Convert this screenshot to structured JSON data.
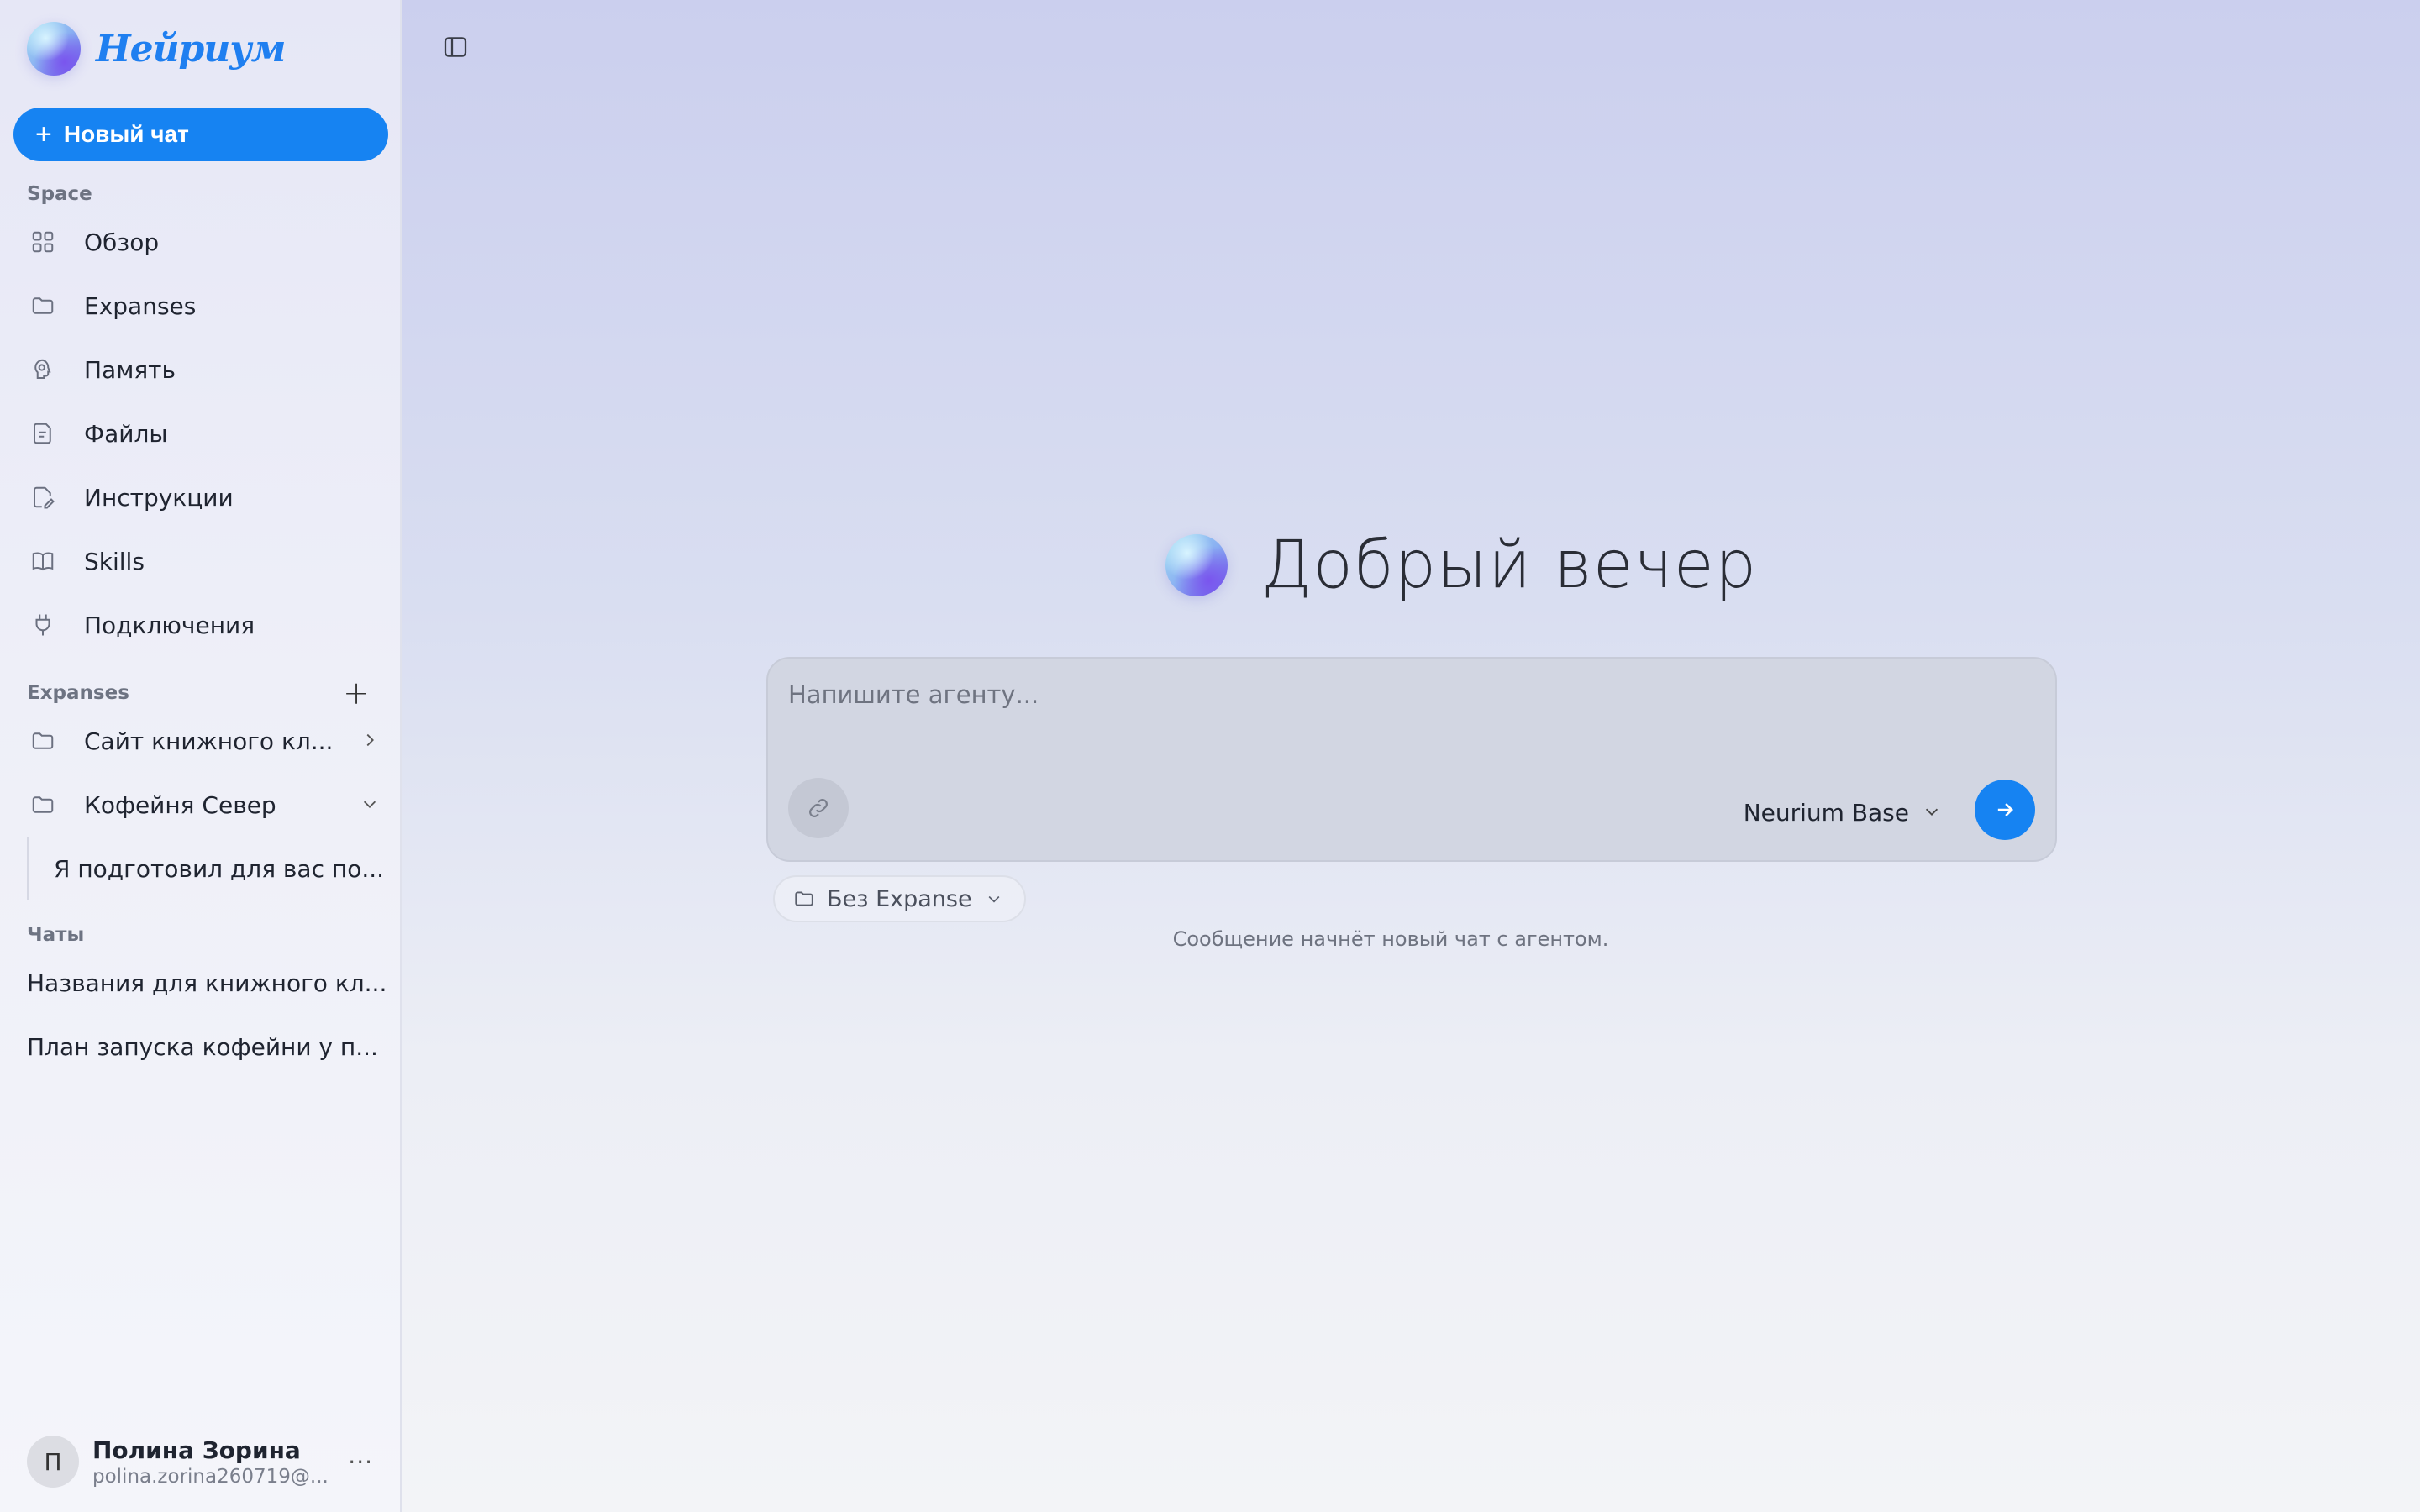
{
  "sidebar": {
    "brand": "Нейриум",
    "new_chat": "Новый чат",
    "space_label": "Space",
    "space_items": [
      {
        "label": "Обзор",
        "icon": "grid-icon"
      },
      {
        "label": "Expanses",
        "icon": "folder-icon"
      },
      {
        "label": "Память",
        "icon": "brain-icon"
      },
      {
        "label": "Файлы",
        "icon": "file-icon"
      },
      {
        "label": "Инструкции",
        "icon": "edit-document-icon"
      },
      {
        "label": "Skills",
        "icon": "book-icon"
      },
      {
        "label": "Подключения",
        "icon": "plug-icon"
      }
    ],
    "expanses_label": "Expanses",
    "expanses": [
      {
        "label": "Сайт книжного кл...",
        "state": "collapsed"
      },
      {
        "label": "Кофейня Север",
        "state": "expanded"
      }
    ],
    "expanse_sub_item": "Я подготовил для вас по...",
    "chats_label": "Чаты",
    "chats": [
      "Названия для книжного кл...",
      "План запуска кофейни у п..."
    ],
    "user": {
      "initial": "П",
      "name": "Полина Зорина",
      "email": "polina.zorina260719@...",
      "more": "···"
    }
  },
  "main": {
    "greeting": "Добрый вечер",
    "composer": {
      "placeholder": "Напишите агенту...",
      "model": "Neurium Base"
    },
    "expanse_selector": "Без Expanse",
    "hint": "Сообщение начнёт новый чат с агентом."
  },
  "colors": {
    "accent": "#1683f2",
    "brand_text": "#1f7ff0"
  }
}
